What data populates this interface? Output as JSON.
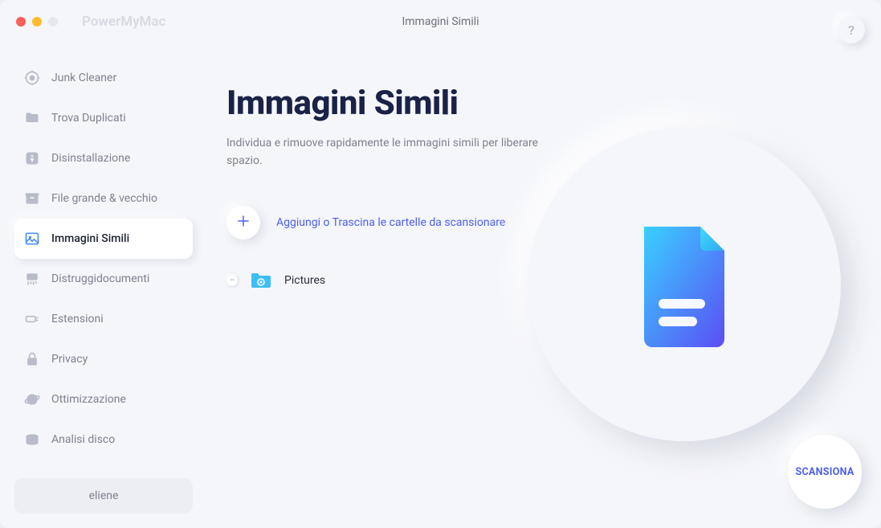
{
  "app_name": "PowerMyMac",
  "window_title": "Immagini Simili",
  "help_label": "?",
  "sidebar": {
    "items": [
      {
        "label": "Junk Cleaner"
      },
      {
        "label": "Trova Duplicati"
      },
      {
        "label": "Disinstallazione"
      },
      {
        "label": "File grande & vecchio"
      },
      {
        "label": "Immagini Simili"
      },
      {
        "label": "Distruggidocumenti"
      },
      {
        "label": "Estensioni"
      },
      {
        "label": "Privacy"
      },
      {
        "label": "Ottimizzazione"
      },
      {
        "label": "Analisi disco"
      }
    ],
    "active_index": 4
  },
  "user_name": "eliene",
  "main": {
    "title": "Immagini Simili",
    "subtitle": "Individua e rimuove rapidamente le immagini simili per liberare spazio.",
    "add_label": "Aggiungi o Trascina le cartelle da scansionare",
    "folders": [
      {
        "name": "Pictures"
      }
    ]
  },
  "scan_label": "SCANSIONA",
  "colors": {
    "accent": "#4b5ef5",
    "title": "#1a2247",
    "muted": "#7e828f"
  }
}
